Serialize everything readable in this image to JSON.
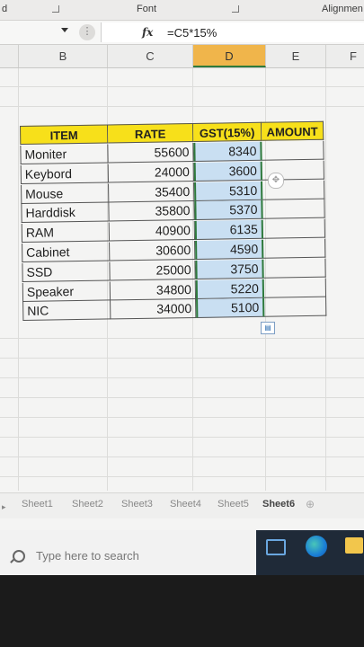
{
  "ribbon": {
    "left_label": "d",
    "font_label": "Font",
    "alignment_label": "Alignmen"
  },
  "formula_bar": {
    "fx_label": "fx",
    "dots_label": "⋮",
    "formula": "=C5*15%"
  },
  "columns": [
    "B",
    "C",
    "D",
    "E",
    "F"
  ],
  "selected_column": "D",
  "table": {
    "headers": [
      "ITEM",
      "RATE",
      "GST(15%)",
      "AMOUNT"
    ],
    "rows": [
      {
        "item": "Moniter",
        "rate": "55600",
        "gst": "8340",
        "amount": ""
      },
      {
        "item": "Keybord",
        "rate": "24000",
        "gst": "3600",
        "amount": ""
      },
      {
        "item": "Mouse",
        "rate": "35400",
        "gst": "5310",
        "amount": ""
      },
      {
        "item": "Harddisk",
        "rate": "35800",
        "gst": "5370",
        "amount": ""
      },
      {
        "item": "RAM",
        "rate": "40900",
        "gst": "6135",
        "amount": ""
      },
      {
        "item": "Cabinet",
        "rate": "30600",
        "gst": "4590",
        "amount": ""
      },
      {
        "item": "SSD",
        "rate": "25000",
        "gst": "3750",
        "amount": ""
      },
      {
        "item": "Speaker",
        "rate": "34800",
        "gst": "5220",
        "amount": ""
      },
      {
        "item": "NIC",
        "rate": "34000",
        "gst": "5100",
        "amount": ""
      }
    ]
  },
  "sheet_tabs": [
    "Sheet1",
    "Sheet2",
    "Sheet3",
    "Sheet4",
    "Sheet5",
    "Sheet6"
  ],
  "active_sheet": "Sheet6",
  "taskbar": {
    "search_placeholder": "Type here to search"
  },
  "colors": {
    "header_fill": "#f7e01a",
    "selection_fill": "#c9dff2",
    "selected_column_header": "#f0b54b",
    "selection_border": "#2f7a3c"
  },
  "icons": [
    "fx-icon",
    "quick-analysis-icon",
    "search-icon",
    "task-view-icon",
    "edge-icon",
    "file-explorer-icon"
  ]
}
